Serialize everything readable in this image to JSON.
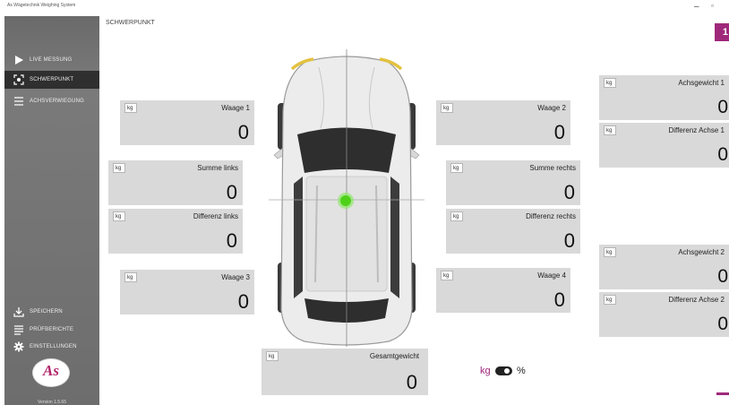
{
  "app": {
    "title": "As Wägetechnik Weighing System"
  },
  "window": {
    "minimize": "–",
    "maximize": "▫"
  },
  "page_title": "SCHWERPUNKT",
  "badge": "1",
  "nav": [
    {
      "label": "LIVE MESSUNG",
      "icon": "play-icon",
      "active": false
    },
    {
      "label": "SCHWERPUNKT",
      "icon": "focus-target-icon",
      "active": true
    },
    {
      "label": "ACHSVERWIEGUNG",
      "icon": "list-icon",
      "active": false
    }
  ],
  "nav_bottom": [
    {
      "label": "SPEICHERN",
      "icon": "download-icon"
    },
    {
      "label": "PRÜFBERICHTE",
      "icon": "report-lines-icon"
    },
    {
      "label": "EINSTELLUNGEN",
      "icon": "gear-icon"
    }
  ],
  "logo_text": "As",
  "version": "Version 1.5.65",
  "unit": "kg",
  "boxes": {
    "waage1": {
      "label": "Waage 1",
      "value": "0"
    },
    "waage2": {
      "label": "Waage 2",
      "value": "0"
    },
    "waage3": {
      "label": "Waage 3",
      "value": "0"
    },
    "waage4": {
      "label": "Waage 4",
      "value": "0"
    },
    "summe_links": {
      "label": "Summe links",
      "value": "0"
    },
    "summe_rechts": {
      "label": "Summe rechts",
      "value": "0"
    },
    "diff_links": {
      "label": "Differenz links",
      "value": "0"
    },
    "diff_rechts": {
      "label": "Differenz rechts",
      "value": "0"
    },
    "achsgewicht1": {
      "label": "Achsgewicht 1",
      "value": "0"
    },
    "diff_achse1": {
      "label": "Differenz Achse 1",
      "value": "0"
    },
    "achsgewicht2": {
      "label": "Achsgewicht 2",
      "value": "0"
    },
    "diff_achse2": {
      "label": "Differenz Achse 2",
      "value": "0"
    },
    "gesamt": {
      "label": "Gesamtgewicht",
      "value": "0"
    }
  },
  "toggle": {
    "left_label": "kg",
    "right_label": "%"
  },
  "colors": {
    "accent": "#a0287a",
    "sidebar": "#6d6d6d",
    "box": "#d9d9d9",
    "center_of_gravity": "#4fd11a"
  }
}
